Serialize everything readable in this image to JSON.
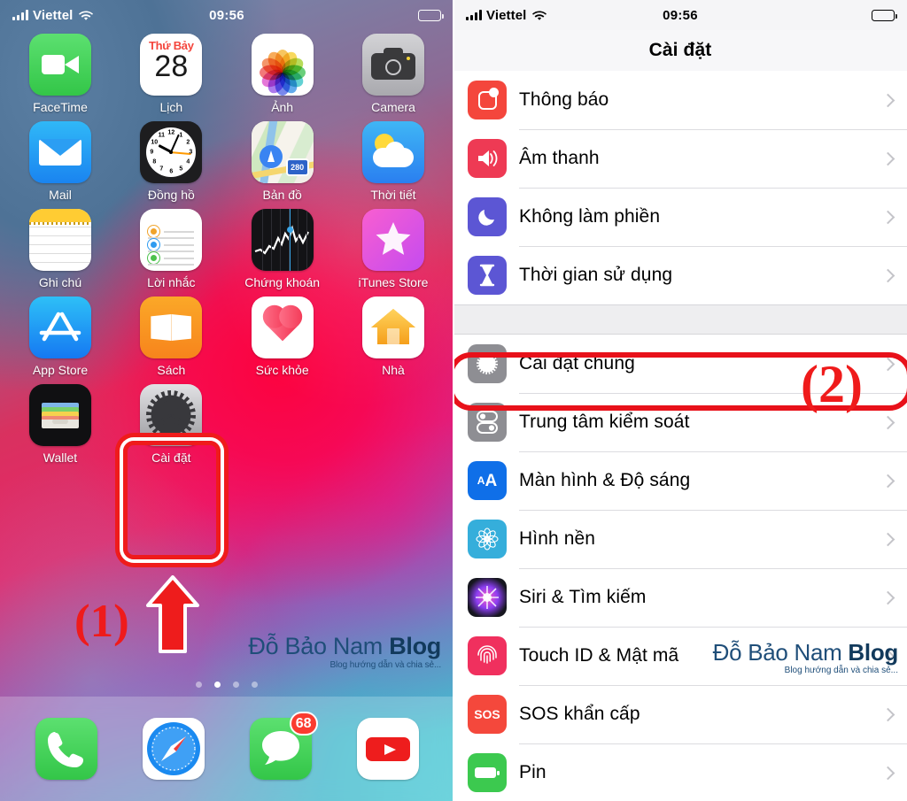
{
  "left_panel": {
    "status_bar": {
      "carrier": "Viettel",
      "time": "09:56",
      "signal_icon": "cellular-bars-icon",
      "wifi_icon": "wifi-icon",
      "battery_icon": "battery-icon"
    },
    "apps_rows": [
      [
        {
          "label": "FaceTime",
          "icon": "facetime-icon"
        },
        {
          "label": "Lịch",
          "icon": "calendar-icon",
          "weekday": "Thứ Bảy",
          "day": "28"
        },
        {
          "label": "Ảnh",
          "icon": "photos-icon"
        },
        {
          "label": "Camera",
          "icon": "camera-icon"
        }
      ],
      [
        {
          "label": "Mail",
          "icon": "mail-icon"
        },
        {
          "label": "Đồng hồ",
          "icon": "clock-icon"
        },
        {
          "label": "Bản đồ",
          "icon": "maps-icon",
          "shield_label": "280"
        },
        {
          "label": "Thời tiết",
          "icon": "weather-icon"
        }
      ],
      [
        {
          "label": "Ghi chú",
          "icon": "notes-icon"
        },
        {
          "label": "Lời nhắc",
          "icon": "reminders-icon"
        },
        {
          "label": "Chứng khoán",
          "icon": "stocks-icon"
        },
        {
          "label": "iTunes Store",
          "icon": "itunes-store-icon"
        }
      ],
      [
        {
          "label": "App Store",
          "icon": "app-store-icon"
        },
        {
          "label": "Sách",
          "icon": "books-icon"
        },
        {
          "label": "Sức khỏe",
          "icon": "health-icon"
        },
        {
          "label": "Nhà",
          "icon": "home-icon"
        }
      ],
      [
        {
          "label": "Wallet",
          "icon": "wallet-icon"
        },
        {
          "label": "Cài đặt",
          "icon": "settings-icon"
        }
      ]
    ],
    "dock": [
      {
        "label": "Phone",
        "icon": "phone-icon"
      },
      {
        "label": "Safari",
        "icon": "safari-icon"
      },
      {
        "label": "Messages",
        "icon": "messages-icon",
        "badge": "68"
      },
      {
        "label": "YouTube",
        "icon": "youtube-icon"
      }
    ],
    "page_dots": {
      "count": 4,
      "active_index": 1
    },
    "annotation": {
      "step": "(1)",
      "arrow_icon": "red-up-arrow-icon",
      "highlight_target": "Cài đặt"
    },
    "watermark": {
      "line1_a": "Đỗ Bảo Nam ",
      "line1_b": "Blog",
      "line2": "Blog hướng dẫn và chia sẻ..."
    }
  },
  "right_panel": {
    "status_bar": {
      "carrier": "Viettel",
      "time": "09:56",
      "signal_icon": "cellular-bars-icon",
      "wifi_icon": "wifi-icon",
      "battery_icon": "battery-icon"
    },
    "nav_title": "Cài đặt",
    "group_1": [
      {
        "label": "Thông báo",
        "icon": "notifications-icon",
        "color": "#f4463c"
      },
      {
        "label": "Âm thanh",
        "icon": "sounds-icon",
        "color": "#ee3a54"
      },
      {
        "label": "Không làm phiền",
        "icon": "do-not-disturb-moon-icon",
        "color": "#5c56d4"
      },
      {
        "label": "Thời gian sử dụng",
        "icon": "screen-time-hourglass-icon",
        "color": "#5c56d4"
      }
    ],
    "group_2": [
      {
        "label": "Cài đặt chung",
        "icon": "general-gear-icon",
        "color": "#8e8e93"
      },
      {
        "label": "Trung tâm kiểm soát",
        "icon": "control-center-toggles-icon",
        "color": "#8e8e93"
      },
      {
        "label": "Màn hình & Độ sáng",
        "icon": "display-brightness-aa-icon",
        "color": "#0f6fe8",
        "glyph": "AA"
      },
      {
        "label": "Hình nền",
        "icon": "wallpaper-flower-icon",
        "color": "#35aedb"
      },
      {
        "label": "Siri & Tìm kiếm",
        "icon": "siri-icon",
        "color": "#8a3df0"
      },
      {
        "label": "Touch ID & Mật mã",
        "icon": "touch-id-fingerprint-icon",
        "color": "#f0305e"
      },
      {
        "label": "SOS khẩn cấp",
        "icon": "emergency-sos-icon",
        "color": "#f4483c",
        "glyph": "SOS"
      },
      {
        "label": "Pin",
        "icon": "battery-icon",
        "color": "#3cc94f"
      }
    ],
    "annotation": {
      "step": "(2)",
      "highlight_target": "Cài đặt chung"
    },
    "watermark": {
      "line1_a": "Đỗ Bảo Nam ",
      "line1_b": "Blog",
      "line2": "Blog hướng dẫn và chia sẻ..."
    }
  }
}
